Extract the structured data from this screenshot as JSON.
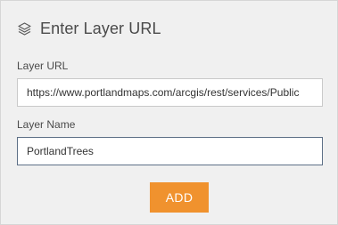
{
  "header": {
    "icon": "layers-icon",
    "title": "Enter Layer URL"
  },
  "form": {
    "url_label": "Layer URL",
    "url_value": "https://www.portlandmaps.com/arcgis/rest/services/Public",
    "name_label": "Layer Name",
    "name_value": "PortlandTrees",
    "add_label": "ADD"
  },
  "colors": {
    "panel_background": "#f0f0f0",
    "accent_button": "#f0922e",
    "focused_border": "#5d6f86"
  }
}
